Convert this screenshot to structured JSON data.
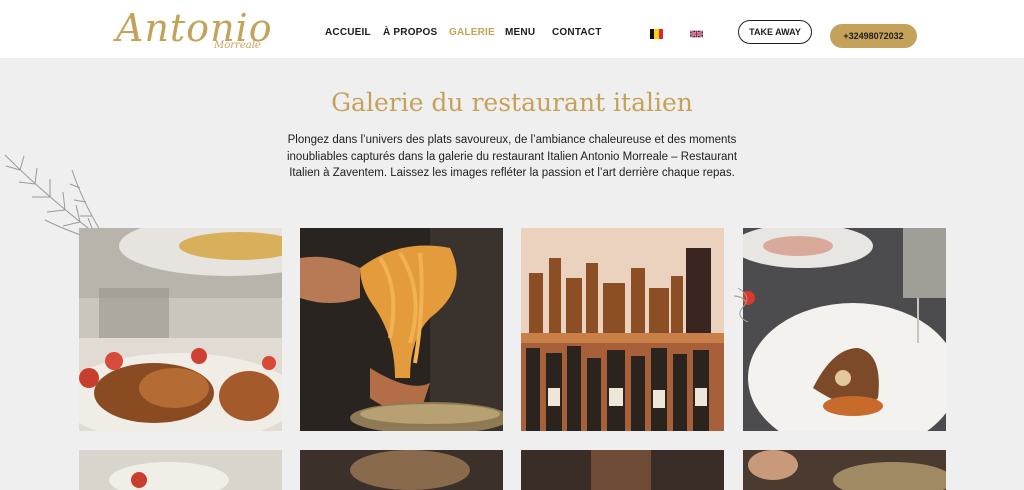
{
  "brand": {
    "name": "Antonio",
    "sub": "Morreale"
  },
  "nav": {
    "items": [
      {
        "label": "ACCUEIL",
        "active": false
      },
      {
        "label": "À PROPOS",
        "active": false
      },
      {
        "label": "GALERIE",
        "active": true
      },
      {
        "label": "MENU",
        "active": false
      },
      {
        "label": "CONTACT",
        "active": false
      }
    ]
  },
  "languages": {
    "be": "belgium-flag-icon",
    "uk": "uk-flag-icon"
  },
  "buttons": {
    "takeaway": "TAKE AWAY",
    "phone": "+32498072032"
  },
  "hero": {
    "title": "Galerie du restaurant italien",
    "intro": "Plongez dans l’univers des plats savoureux, de l’ambiance chaleureuse et des moments inoubliables capturés dans la galerie du restaurant Italien Antonio Morreale – Restaurant Italien à Zaventem. Laissez les images refléter la passion et l’art derrière chaque repas."
  },
  "colors": {
    "accent": "#c5a25a",
    "page_bg": "#efefef",
    "header_bg": "#ffffff",
    "text": "#1d1d1d"
  },
  "gallery": [
    {
      "name": "octopus-dish-photo"
    },
    {
      "name": "pasta-twirl-photo"
    },
    {
      "name": "liquor-shelf-photo"
    },
    {
      "name": "plated-dish-wine-photo"
    },
    {
      "name": "gallery-photo-5"
    },
    {
      "name": "gallery-photo-6"
    },
    {
      "name": "gallery-photo-7"
    },
    {
      "name": "gallery-photo-8"
    }
  ]
}
